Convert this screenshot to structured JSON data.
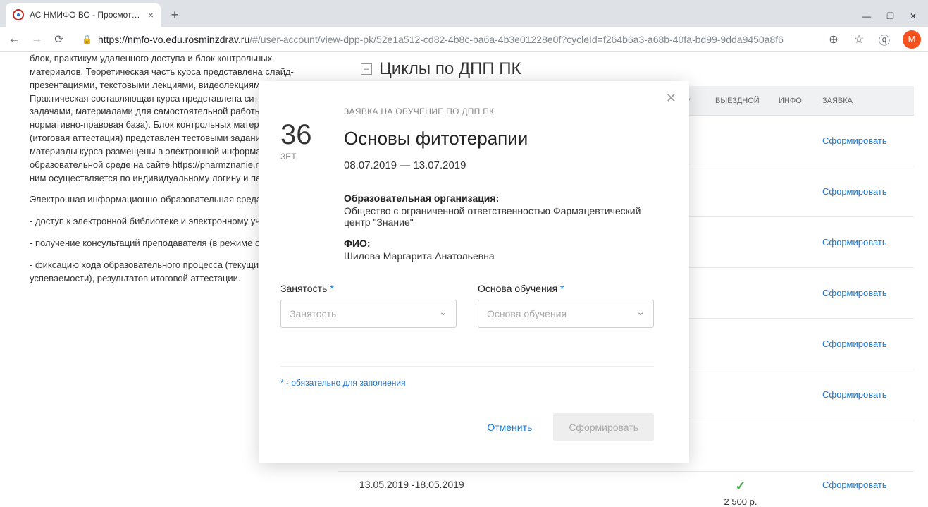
{
  "browser": {
    "tab_title": "АС НМИФО ВО - Просмотр ДП",
    "new_tab": "+",
    "win_min": "—",
    "win_max": "❐",
    "win_close": "✕",
    "url_host": "https://nmfo-vo.edu.rosminzdrav.ru",
    "url_path": "/#/user-account/view-dpp-pk/52e1a512-cd82-4b8c-ba6a-4b3e01228e0f?cycleId=f264b6a3-a68b-40fa-bd99-9dda9450a8f6",
    "avatar_letter": "М"
  },
  "bg": {
    "p1": "блок, практикум удаленного доступа и блок контрольных материалов. Теоретическая часть курса представлена слайд-презентациями, текстовыми лекциями, видеолекциями. Практическая составляющая курса представлена ситуационными задачами, материалами для самостоятельной работы (современная нормативно-правовая база). Блок контрольных материалов (итоговая аттестация) представлен тестовыми заданиями. Все материалы курса размещены в электронной информационно-образовательной среде на сайте https://pharmznanie.ru/, доступ к ним осуществляется по индивидуальному логину и паролю.",
    "p2": "Электронная информационно-образовательная среда обеспечивает:",
    "p3": "- доступ к электронной библиотеке и электронному учебному курсу;",
    "p4": "- получение консультаций преподавателя (в режиме offline);",
    "p5": "- фиксацию хода образовательного процесса (текущий контроль успеваемости), результатов итоговой аттестации."
  },
  "section": {
    "collapse": "–",
    "title": "Циклы по ДПП ПК"
  },
  "thead": {
    "tfoms": "ТФОМС*",
    "out": "ВЫЕЗДНОЙ",
    "info": "ИНФО",
    "app": "ЗАЯВКА"
  },
  "rows": [
    {
      "app": "Сформировать"
    },
    {
      "app": "Сформировать"
    },
    {
      "app": "Сформировать"
    },
    {
      "app": "Сформировать"
    },
    {
      "app": "Сформировать"
    },
    {
      "app": "Сформировать"
    }
  ],
  "lastrow": {
    "dates": "13.05.2019 -18.05.2019",
    "check": "✓",
    "price": "2 500 р.",
    "app": "Сформировать"
  },
  "modal": {
    "close": "✕",
    "zet_num": "36",
    "zet_lbl": "ЗЕТ",
    "pretitle": "ЗАЯВКА НА ОБУЧЕНИЕ ПО ДПП ПК",
    "title": "Основы фитотерапии",
    "dates": "08.07.2019 — 13.07.2019",
    "org_label": "Образовательная организация:",
    "org_val": "Общество с ограниченной ответственностью Фармацевтический центр \"Знание\"",
    "fio_label": "ФИО:",
    "fio_val": "Шилова Маргарита Анатольевна",
    "employ_label": "Занятость",
    "employ_placeholder": "Занятость",
    "basis_label": "Основа обучения",
    "basis_placeholder": "Основа обучения",
    "star": " *",
    "note": "* - обязательно для заполнения",
    "cancel": "Отменить",
    "submit": "Сформировать"
  }
}
